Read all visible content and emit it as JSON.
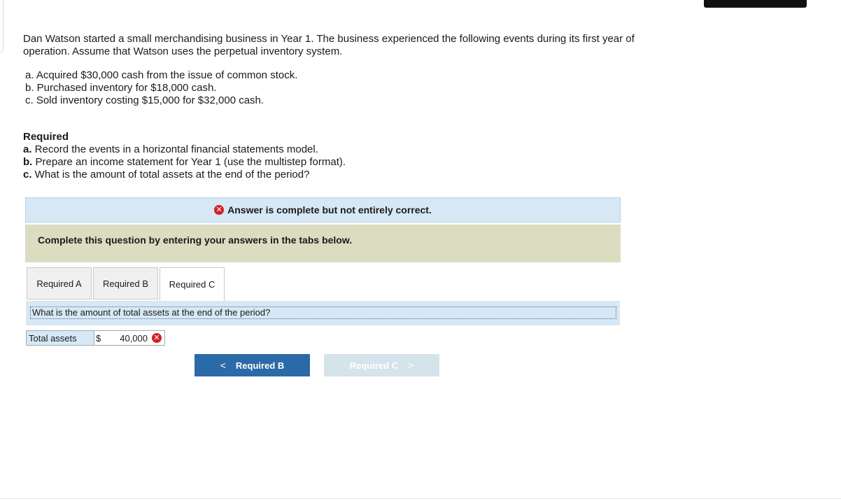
{
  "problem": {
    "intro": "Dan Watson started a small merchandising business in Year 1. The business experienced the following events during its first year of operation. Assume that Watson uses the perpetual inventory system.",
    "events": [
      "a. Acquired $30,000 cash from the issue of common stock.",
      "b. Purchased inventory for $18,000 cash.",
      "c. Sold inventory costing $15,000 for $32,000 cash."
    ]
  },
  "required": {
    "title": "Required",
    "items": [
      {
        "letter": "a.",
        "text": " Record the events in a horizontal financial statements model."
      },
      {
        "letter": "b.",
        "text": " Prepare an income statement for Year 1 (use the multistep format)."
      },
      {
        "letter": "c.",
        "text": " What is the amount of total assets at the end of the period?"
      }
    ]
  },
  "status": {
    "message": "Answer is complete but not entirely correct.",
    "icon": "x-circle-icon",
    "icon_color": "#d41f26"
  },
  "instruction": "Complete this question by entering your answers in the tabs below.",
  "tabs": [
    {
      "label": "Required A",
      "active": false
    },
    {
      "label": "Required B",
      "active": false
    },
    {
      "label": "Required C",
      "active": true
    }
  ],
  "panel": {
    "question": "What is the amount of total assets at the end of the period?",
    "answer_label": "Total assets",
    "currency": "$",
    "answer_value": "40,000",
    "answer_status": "incorrect"
  },
  "navigation": {
    "prev_label": "Required B",
    "next_label": "Required C",
    "prev_color": "#2b6aa8",
    "next_color": "#d5e3ea"
  }
}
